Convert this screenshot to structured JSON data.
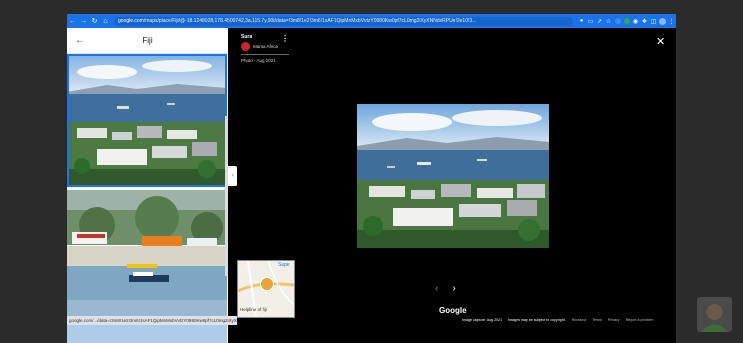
{
  "browser": {
    "url_host": "google.com",
    "url_rest": "/maps/place/Fiji/@-18.1248028,178.4500742,3a,115.7y,90t/data=!3m8!1e2!3m6!1sAF1QipMnMxbVvtzY0980Kw0pf7cL0mg2iXyXNNdxRPUe!2e10!3...",
    "status_link": "google.com/.../data=!3m8!1e2!3m6!1sAF1QipMnMxbVvtzY0980Kw0pf7cL0mg2iXyXNNdxRPUe!2e10!6s..."
  },
  "left_panel": {
    "title": "Fiji"
  },
  "viewer": {
    "author": "Sura",
    "author_sub": "Mama Africa",
    "photo_date": "Photo - Aug 2021",
    "minimap_label": "Helpline of fiji",
    "minimap_sup": "Supe",
    "google_label": "Google",
    "footer": {
      "capture": "Image capture: Aug 2021",
      "copyright": "Images may be subject to copyright.",
      "links": [
        "Romania",
        "Terms",
        "Privacy",
        "Report a problem"
      ]
    }
  },
  "colors": {
    "brand": "#1a73e8",
    "viewer_bg": "#000000"
  }
}
